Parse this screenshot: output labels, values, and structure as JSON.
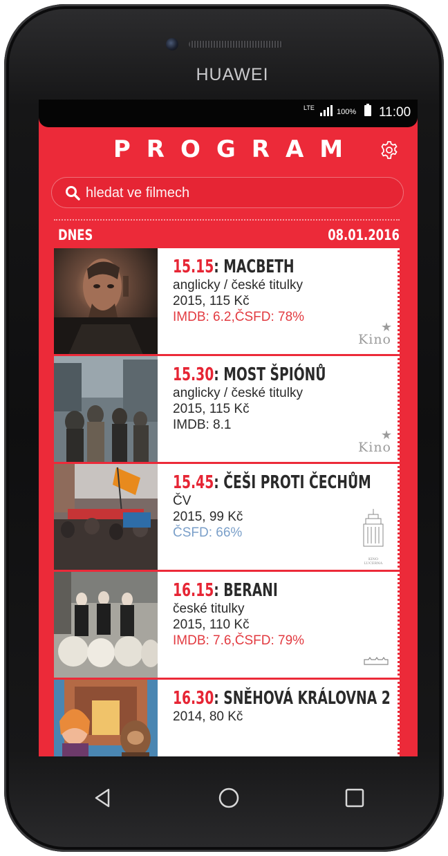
{
  "device": {
    "brand": "HUAWEI"
  },
  "status_bar": {
    "network": "LTE",
    "battery": "100%",
    "time": "11:00"
  },
  "header": {
    "title": "PROGRAM",
    "settings_icon": "gear-icon"
  },
  "search": {
    "placeholder": "hledat ve filmech",
    "icon": "search-icon"
  },
  "day": {
    "label": "DNES",
    "date": "08.01.2016"
  },
  "movies": [
    {
      "time": "15.15",
      "title": "MACBETH",
      "language": "anglicky / české titulky",
      "year_price": "2015, 115 Kč",
      "rating": "IMDB: 6.2,ČSFD: 78%",
      "rating_color": "#e23a40",
      "cinema": "Kino"
    },
    {
      "time": "15.30",
      "title": "MOST ŠPIÓNŮ",
      "language": "anglicky / české titulky",
      "year_price": "2015, 115 Kč",
      "rating": "IMDB: 8.1",
      "rating_color": "#2a2a2a",
      "cinema": "Kino"
    },
    {
      "time": "15.45",
      "title": "ČEŠI PROTI ČECHŮM",
      "language": "ČV",
      "year_price": "2015, 99 Kč",
      "rating": "ČSFD: 66%",
      "rating_color": "#7a9fc9",
      "cinema": "KINO LUCERNA"
    },
    {
      "time": "16.15",
      "title": "BERANI",
      "language": "české titulky",
      "year_price": "2015, 110 Kč",
      "rating": "IMDB: 7.6,ČSFD: 79%",
      "rating_color": "#e23a40",
      "cinema": "cinema-logo"
    },
    {
      "time": "16.30",
      "title": "SNĚHOVÁ KRÁLOVNA 2",
      "language": "2014, 80 Kč",
      "year_price": "",
      "rating": "",
      "rating_color": "#2a2a2a",
      "cinema": ""
    }
  ],
  "navigation": {
    "back_icon": "back-triangle-icon",
    "home_icon": "home-circle-icon",
    "recents_icon": "recents-square-icon"
  },
  "colors": {
    "accent": "#ec2a39",
    "time_red": "#e62534"
  }
}
